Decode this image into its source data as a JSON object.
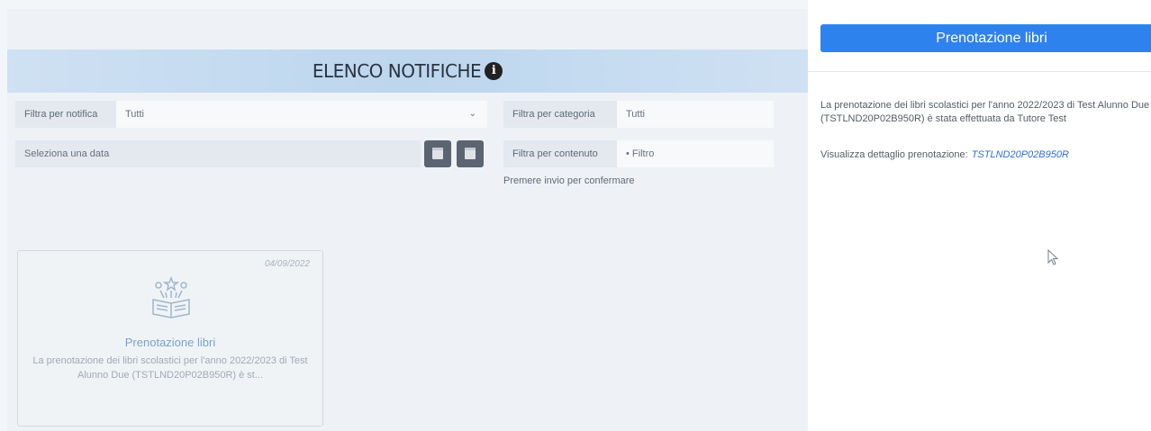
{
  "page": {
    "title": "ELENCO NOTIFICHE",
    "filters": {
      "notifica_label": "Filtra per notifica",
      "notifica_value": "Tutti",
      "categoria_label": "Filtra per categoria",
      "categoria_value": "Tutti",
      "data_placeholder": "Seleziona una data",
      "contenuto_label": "Filtra per contenuto",
      "contenuto_placeholder": "• Filtro",
      "hint": "Premere invio per confermare"
    },
    "card": {
      "date": "04/09/2022",
      "title": "Prenotazione libri",
      "body": "La prenotazione dei libri scolastici per l'anno 2022/2023 di Test Alunno Due (TSTLND20P02B950R) è st..."
    }
  },
  "panel": {
    "header": "Prenotazione libri",
    "text": "La prenotazione dei libri scolastici per l'anno 2022/2023 di Test Alunno Due (TSTLND20P02B950R) è stata effettuata da Tutore Test",
    "link_label": "Visualizza dettaglio prenotazione:",
    "link_code": "TSTLND20P02B950R"
  },
  "colors": {
    "accent": "#2e82ee",
    "link": "#2e6fd6"
  }
}
